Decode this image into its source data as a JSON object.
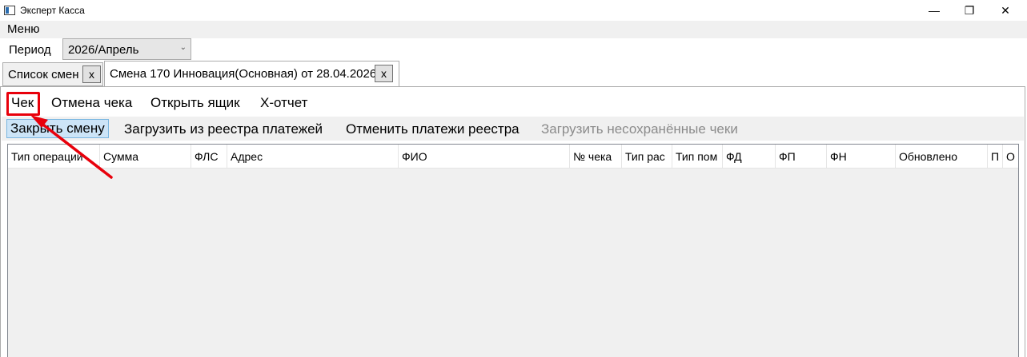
{
  "window": {
    "title": "Эксперт Касса",
    "controls": {
      "minimize": "—",
      "maximize": "❐",
      "close": "✕"
    }
  },
  "menu": {
    "label": "Меню"
  },
  "period": {
    "label": "Период",
    "value": "2026/Апрель"
  },
  "tabs": [
    {
      "label": "Список смен",
      "close": "x"
    },
    {
      "label": "Смена 170 Инновация(Основная) от 28.04.2026",
      "close": "x"
    }
  ],
  "toolbar1": {
    "check": "Чек",
    "cancel_check": "Отмена чека",
    "open_drawer": "Открыть ящик",
    "x_report": "Х-отчет"
  },
  "toolbar2": {
    "close_shift": "Закрыть смену",
    "load_registry": "Загрузить из реестра платежей",
    "cancel_registry": "Отменить платежи реестра",
    "load_unsaved": "Загрузить несохранённые чеки"
  },
  "grid": {
    "columns": [
      "Тип операции",
      "Сумма",
      "ФЛС",
      "Адрес",
      "ФИО",
      "№ чека",
      "Тип рас",
      "Тип пом",
      "ФД",
      "ФП",
      "ФН",
      "Обновлено",
      "П",
      "О"
    ]
  },
  "annotation": {
    "color": "#e8000b"
  }
}
